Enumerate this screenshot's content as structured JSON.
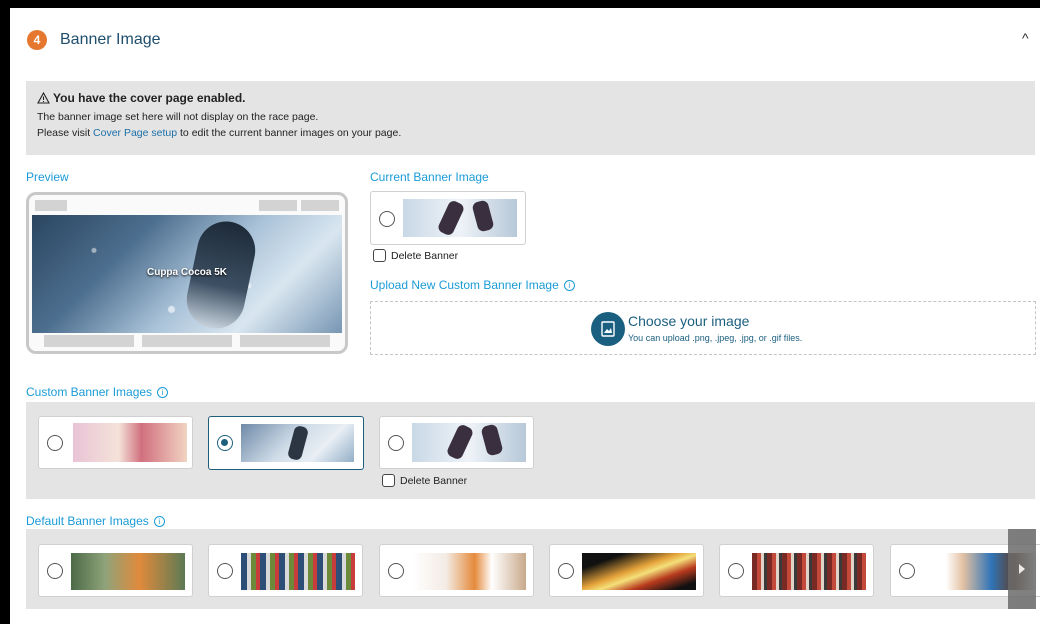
{
  "header": {
    "step": "4",
    "title": "Banner Image",
    "collapse_glyph": "^"
  },
  "alert": {
    "heading": "You have the cover page enabled.",
    "line1": "The banner image set here will not display on the race page.",
    "line2_prefix": "Please visit",
    "line2_link": "Cover Page setup",
    "line2_suffix": "to edit the current banner images on your page."
  },
  "preview": {
    "label": "Preview",
    "banner_text": "Cuppa Cocoa 5K"
  },
  "current": {
    "label": "Current Banner Image",
    "delete_label": "Delete Banner"
  },
  "upload": {
    "label": "Upload New Custom Banner Image",
    "title": "Choose your image",
    "subtitle": "You can upload .png, .jpeg, .jpg, or .gif files."
  },
  "custom": {
    "label": "Custom Banner Images",
    "delete_label": "Delete Banner",
    "items": [
      {
        "name": "kids-winter-hats",
        "selected": false
      },
      {
        "name": "snow-running-shoe",
        "selected": true
      },
      {
        "name": "snow-running-legs",
        "selected": false
      }
    ]
  },
  "defaults": {
    "label": "Default Banner Images",
    "items": [
      {
        "name": "runners-group"
      },
      {
        "name": "race-start-crowd"
      },
      {
        "name": "runners-silhouette"
      },
      {
        "name": "light-trails"
      },
      {
        "name": "track-race"
      },
      {
        "name": "runners-closeup"
      }
    ]
  },
  "colors": {
    "accent": "#1a9bd7",
    "brand": "#1f5f7e",
    "badge": "#e6772e"
  }
}
